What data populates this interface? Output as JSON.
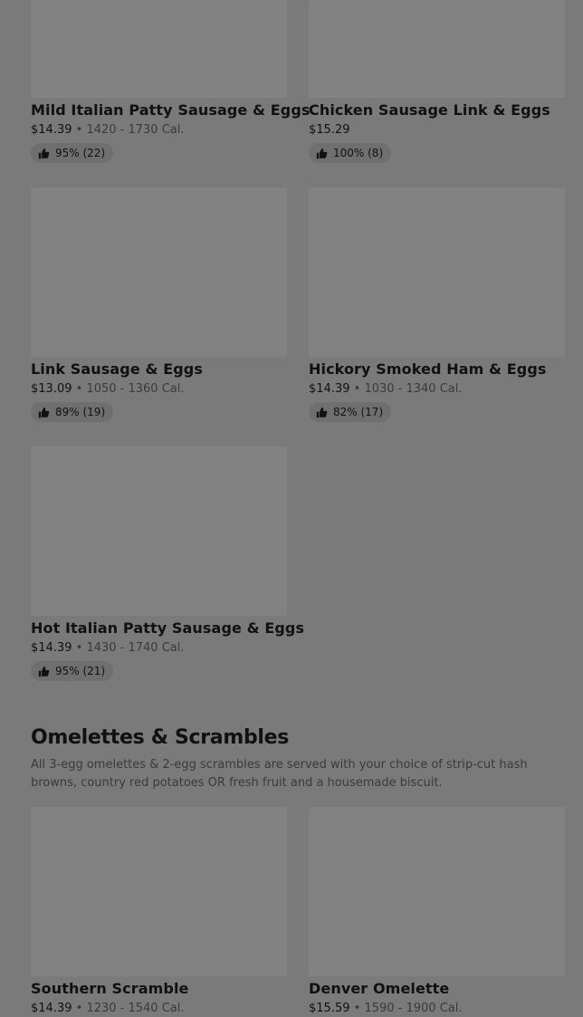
{
  "items_top": [
    {
      "title": "Mild Italian Patty Sausage & Eggs",
      "price": "$14.39",
      "calories": "1420 - 1730 Cal.",
      "rating": "95% (22)"
    },
    {
      "title": "Chicken Sausage Link & Eggs",
      "price": "$15.29",
      "calories": "",
      "rating": "100% (8)"
    },
    {
      "title": "Link Sausage & Eggs",
      "price": "$13.09",
      "calories": "1050 - 1360 Cal.",
      "rating": "89% (19)"
    },
    {
      "title": "Hickory Smoked Ham & Eggs",
      "price": "$14.39",
      "calories": "1030 - 1340 Cal.",
      "rating": "82% (17)"
    },
    {
      "title": "Hot Italian Patty Sausage & Eggs",
      "price": "$14.39",
      "calories": "1430 - 1740 Cal.",
      "rating": "95% (21)"
    }
  ],
  "section": {
    "title": "Omelettes & Scrambles",
    "description": "All 3-egg omelettes & 2-egg scrambles are served with your choice of strip-cut hash browns, country red potatoes OR fresh fruit and a housemade biscuit."
  },
  "items_bottom": [
    {
      "title": "Southern Scramble",
      "price": "$14.39",
      "calories": "1230 - 1540 Cal."
    },
    {
      "title": "Denver Omelette",
      "price": "$15.59",
      "calories": "1590 - 1900 Cal."
    }
  ],
  "icons": {
    "rating": "thumbs-up-icon"
  },
  "colors": {
    "overlay": "#7a7a7a",
    "image_placeholder": "#828282",
    "rating_pill": "#6f6f6f"
  }
}
